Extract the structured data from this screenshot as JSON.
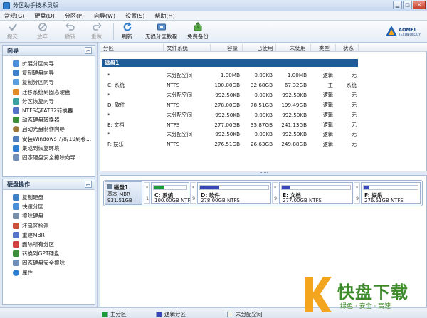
{
  "window": {
    "title": "分区助手技术员版"
  },
  "menu": [
    "常规(G)",
    "硬盘(D)",
    "分区(P)",
    "向导(W)",
    "设置(S)",
    "帮助(H)"
  ],
  "toolbar": {
    "commit": "提交",
    "discard": "放弃",
    "undo": "撤销",
    "redo": "重做",
    "refresh": "刷新",
    "tutorial": "无损分区教程",
    "backup": "免费备份"
  },
  "brand": {
    "name": "AOMEI",
    "sub": "TECHNOLOGY"
  },
  "wizard_panel": {
    "title": "向导",
    "items": [
      "扩展分区向导",
      "复制硬盘向导",
      "复制分区向导",
      "迁移系统到固态硬盘",
      "分区恢复向导",
      "NTFS与FAT32转换器",
      "动态硬盘转换器",
      "启动光盘制作向导",
      "安装Windows 7/8/10到移...",
      "集成到恢复环境",
      "固态硬盘安全擦除向导"
    ]
  },
  "disk_ops_panel": {
    "title": "硬盘操作",
    "items": [
      "复制硬盘",
      "快速分区",
      "擦除硬盘",
      "坏扇区检测",
      "重建MBR",
      "删除所有分区",
      "转换到GPT硬盘",
      "固态硬盘安全擦除",
      "属性"
    ]
  },
  "columns": [
    "分区",
    "文件系统",
    "容量",
    "已使用",
    "未使用",
    "类型",
    "状态"
  ],
  "disk_label": "磁盘1",
  "partitions": [
    {
      "name": "*",
      "fs": "未分配空间",
      "cap": "1.00MB",
      "used": "0.00KB",
      "free": "1.00MB",
      "type": "逻辑",
      "status": "无"
    },
    {
      "name": "C: 系统",
      "fs": "NTFS",
      "cap": "100.00GB",
      "used": "32.68GB",
      "free": "67.32GB",
      "type": "主",
      "status": "系统"
    },
    {
      "name": "*",
      "fs": "未分配空间",
      "cap": "992.50KB",
      "used": "0.00KB",
      "free": "992.50KB",
      "type": "逻辑",
      "status": "无"
    },
    {
      "name": "D: 软件",
      "fs": "NTFS",
      "cap": "278.00GB",
      "used": "78.51GB",
      "free": "199.49GB",
      "type": "逻辑",
      "status": "无"
    },
    {
      "name": "*",
      "fs": "未分配空间",
      "cap": "992.50KB",
      "used": "0.00KB",
      "free": "992.50KB",
      "type": "逻辑",
      "status": "无"
    },
    {
      "name": "E: 文档",
      "fs": "NTFS",
      "cap": "277.00GB",
      "used": "35.87GB",
      "free": "241.13GB",
      "type": "逻辑",
      "status": "无"
    },
    {
      "name": "*",
      "fs": "未分配空间",
      "cap": "992.50KB",
      "used": "0.00KB",
      "free": "992.50KB",
      "type": "逻辑",
      "status": "无"
    },
    {
      "name": "F: 娱乐",
      "fs": "NTFS",
      "cap": "276.51GB",
      "used": "26.63GB",
      "free": "249.88GB",
      "type": "逻辑",
      "status": "无"
    }
  ],
  "disk_map": {
    "name": "磁盘1",
    "type": "基本 MBR",
    "size": "931.51GB",
    "unalloc_star": "*",
    "unalloc_num": "1",
    "unalloc_num_9": "9",
    "segments": [
      {
        "name": "C: 系统",
        "size": "100.00GB NTFS",
        "used_fraction": 0.33,
        "color": "#1f9a38"
      },
      {
        "name": "D: 软件",
        "size": "278.00GB NTFS",
        "used_fraction": 0.28,
        "color": "#3a46b8"
      },
      {
        "name": "E: 文档",
        "size": "277.00GB NTFS",
        "used_fraction": 0.13,
        "color": "#3a46b8"
      },
      {
        "name": "F: 娱乐",
        "size": "276.51GB NTFS",
        "used_fraction": 0.1,
        "color": "#3a46b8"
      }
    ]
  },
  "legend": {
    "primary": "主分区",
    "logical": "逻辑分区",
    "unallocated": "未分配空间",
    "primary_color": "#1f9a38",
    "logical_color": "#3a46b8",
    "unallocated_color": "#f2f2e6"
  },
  "watermark": {
    "logo": "K",
    "title": "快盘下载",
    "slogan": "绿色 · 安全 · 高速"
  }
}
